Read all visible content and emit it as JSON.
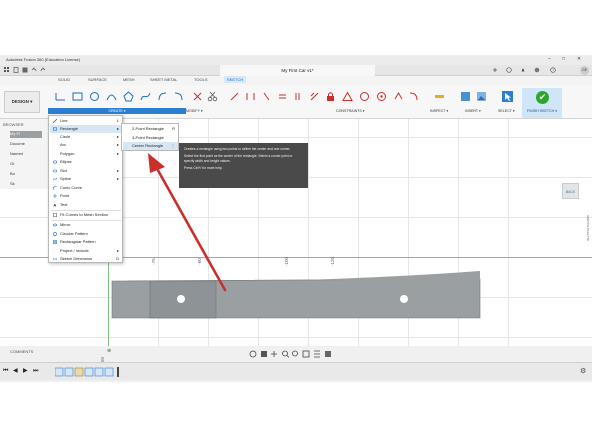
{
  "window": {
    "app_title": "Autodesk Fusion 360 (Education License)",
    "document_title": "My First Car v1*",
    "user_initials": "CE"
  },
  "tabs": [
    "SOLID",
    "SURFACE",
    "MESH",
    "SHEET METAL",
    "TOOLS",
    "SKETCH"
  ],
  "active_tab": "SKETCH",
  "toolbar": {
    "design_label": "DESIGN",
    "create_label": "CREATE",
    "modify_label": "MODIFY",
    "constraints_label": "CONSTRAINTS",
    "inspect_label": "INSPECT",
    "insert_label": "INSERT",
    "select_label": "SELECT",
    "finish_sketch_label": "FINISH SKETCH",
    "finish_check": "✔"
  },
  "browser": {
    "header": "BROWSER",
    "items": [
      "My Fi",
      "Docume",
      "Named",
      "Or",
      "Bo",
      "Sk"
    ]
  },
  "create_menu": {
    "items": [
      {
        "label": "Line",
        "shortcut": "L"
      },
      {
        "label": "Rectangle",
        "has_submenu": true
      },
      {
        "label": "Circle",
        "has_submenu": true
      },
      {
        "label": "Arc",
        "has_submenu": true
      },
      {
        "label": "Polygon",
        "has_submenu": true
      },
      {
        "label": "Ellipse"
      },
      {
        "label": "Slot",
        "has_submenu": true
      },
      {
        "label": "Spline",
        "has_submenu": true
      },
      {
        "label": "Conic Curve"
      },
      {
        "label": "Point"
      },
      {
        "label": "Text"
      },
      {
        "label": "Fit Curves to Mesh Section"
      },
      {
        "label": "Mirror"
      },
      {
        "label": "Circular Pattern"
      },
      {
        "label": "Rectangular Pattern"
      },
      {
        "label": "Project / Include",
        "has_submenu": true
      },
      {
        "label": "Sketch Dimension",
        "shortcut": "D"
      }
    ]
  },
  "rectangle_submenu": {
    "items": [
      {
        "label": "2-Point Rectangle",
        "shortcut": "R"
      },
      {
        "label": "3-Point Rectangle"
      },
      {
        "label": "Center Rectangle"
      }
    ],
    "highlighted": "Center Rectangle"
  },
  "tooltip": {
    "p1": "Creates a rectangle using two points to define the center and one corner.",
    "p2": "Select the first point as the center of the rectangle. Select a corner point or specify width and height values.",
    "p3": "Press Ctrl+/ for more help."
  },
  "ruler_labels": [
    "-75",
    "-60",
    "-100",
    "-125"
  ],
  "vertical_ruler_label": "50",
  "comments_label": "COMMENTS",
  "viewcube_label": "BACK",
  "sketch_palette_label": "SKETCH PALETTE",
  "timeline": {
    "controls": [
      "⏮",
      "◀",
      "▶",
      "⏭"
    ]
  },
  "colors": {
    "accent": "#2b7fd0",
    "finish": "#29a82e",
    "arrow": "#c9302c",
    "body": "#9aa0a2"
  }
}
